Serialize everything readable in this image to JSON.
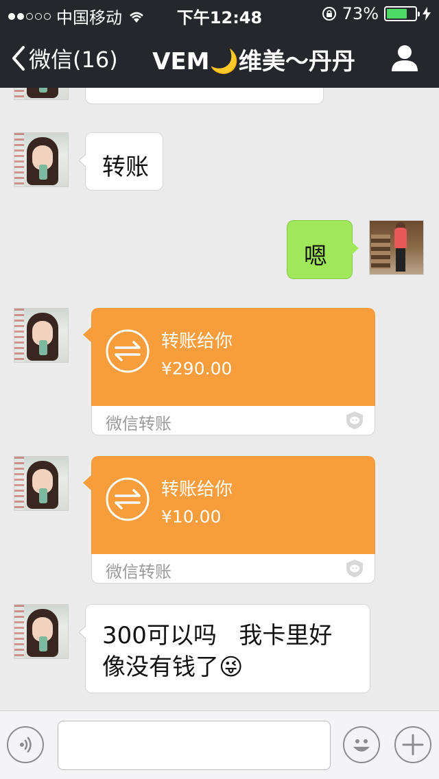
{
  "status_bar": {
    "carrier": "中国移动",
    "time": "下午12:48",
    "battery": "73%",
    "battery_level": 0.73,
    "signal_filled": 2,
    "signal_total": 5
  },
  "nav": {
    "back_label": "微信(16)",
    "title": "VEM🌙维美～丹丹"
  },
  "messages": [
    {
      "type": "text",
      "side": "left",
      "text": "转账"
    },
    {
      "type": "text",
      "side": "right",
      "text": "嗯"
    },
    {
      "type": "transfer",
      "side": "left",
      "title": "转账给你",
      "amount": "¥290.00",
      "source": "微信转账"
    },
    {
      "type": "transfer",
      "side": "left",
      "title": "转账给你",
      "amount": "¥10.00",
      "source": "微信转账"
    },
    {
      "type": "text",
      "side": "left",
      "line1": "300可以吗   我卡里好",
      "line2": "像没有钱了😜"
    }
  ],
  "input": {
    "placeholder": ""
  },
  "colors": {
    "header": "#25272c",
    "background": "#ebebeb",
    "sent_bubble": "#a0e75a",
    "transfer": "#f89d3c"
  }
}
